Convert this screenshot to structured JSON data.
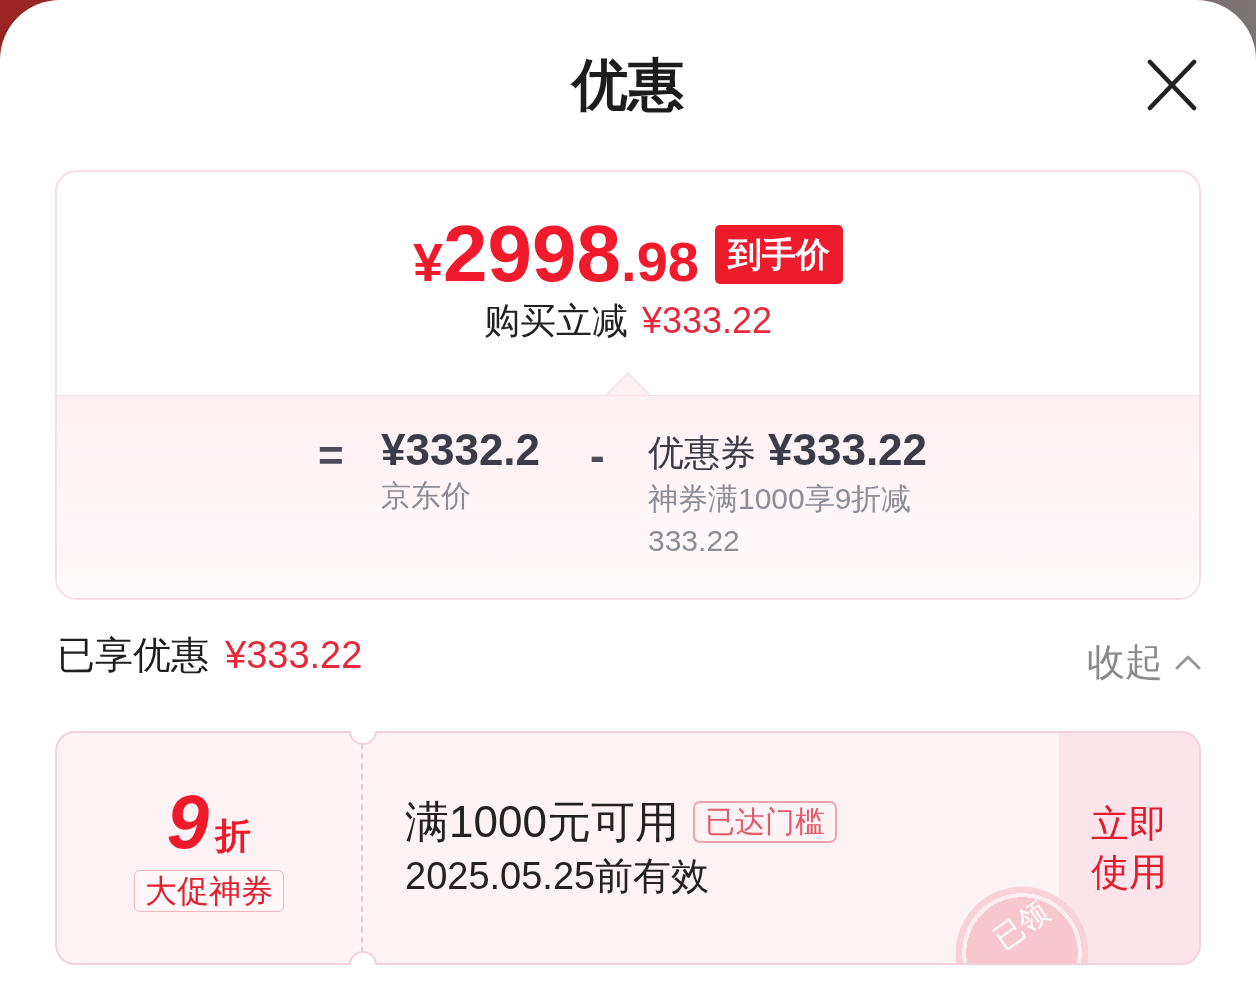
{
  "header": {
    "title": "优惠"
  },
  "price_card": {
    "price": {
      "symbol": "¥",
      "integer": "2998",
      "decimal": ".98"
    },
    "price_tag": "到手价",
    "instant_discount": {
      "label": "购买立减",
      "amount": "¥333.22"
    },
    "breakdown": {
      "equals": "=",
      "jd_price": {
        "amount": "¥3332.2",
        "label": "京东价"
      },
      "minus": "-",
      "coupon": {
        "label": "优惠券",
        "amount": "¥333.22",
        "detail": "神券满1000享9折减333.22"
      }
    }
  },
  "savings": {
    "label": "已享优惠",
    "amount": "¥333.22",
    "toggle": {
      "label": "收起",
      "expanded": true
    }
  },
  "coupons": [
    {
      "value": "9",
      "unit": "折",
      "tag": "大促神券",
      "condition": "满1000元可用",
      "badge": "已达门槛",
      "validity": "2025.05.25前有效",
      "action": "立即使用",
      "stamp": "已领"
    }
  ]
}
